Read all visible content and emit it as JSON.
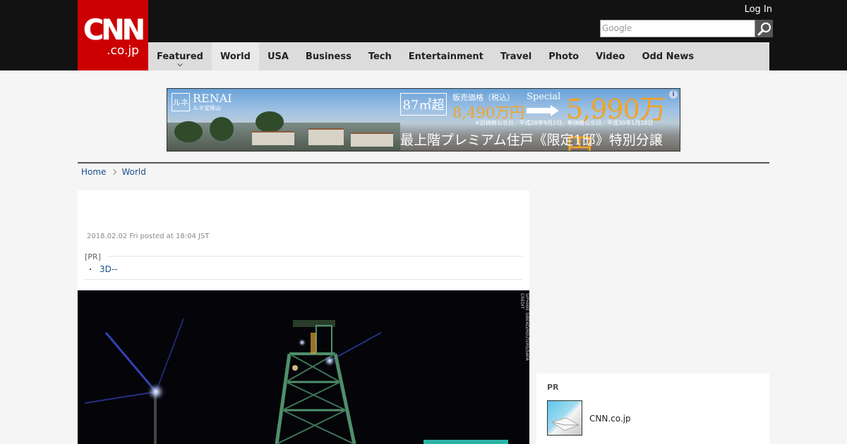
{
  "header": {
    "logo_main": "CNN",
    "logo_sub": ".co.jp",
    "login_label": "Log In",
    "search_placeholder": "Google",
    "nav": [
      {
        "label": "Featured",
        "active": true
      },
      {
        "label": "World",
        "active": true
      },
      {
        "label": "USA"
      },
      {
        "label": "Business"
      },
      {
        "label": "Tech"
      },
      {
        "label": "Entertainment"
      },
      {
        "label": "Travel"
      },
      {
        "label": "Photo"
      },
      {
        "label": "Video"
      },
      {
        "label": "Odd News"
      }
    ],
    "colors": {
      "brand": "#cc0000",
      "bar": "#121212",
      "nav_bg": "#dcdcdc"
    }
  },
  "ad": {
    "logo_mark": "ルネ",
    "brand": "RENAI",
    "brand_sub": "ルネ宝塚山",
    "area": "87㎡超",
    "price_label": "販売価格（税込）",
    "price": "8,490万円",
    "special_label": "Special",
    "special_price": "5,990万円",
    "note": "※旧価格公示日／平成28年9月2日、新価格公示日／平成30年1月18日",
    "tagline": "最上階プレミアム住戸《限定1邸》特別分譲",
    "info_icon": "i"
  },
  "breadcrumb": [
    {
      "label": "Home"
    },
    {
      "label": "World"
    }
  ],
  "article": {
    "posted": "2018.02.02 Fri posted at 18:04 JST",
    "pr_label": "[PR]",
    "pr_bullet": "・",
    "pr_link": "3D--",
    "photo_credit": "SIPHIWE SIBEKO/REUTERS/SAFA CREDIT"
  },
  "sidebar": {
    "pr_label": "PR",
    "items": [
      {
        "title": "CNN.co.jp"
      }
    ]
  }
}
